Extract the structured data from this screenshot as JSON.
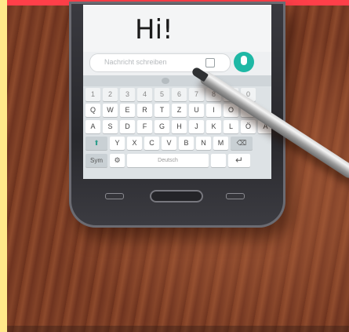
{
  "scene": {
    "message_text": "Hi!",
    "input_placeholder": "Nachricht schreiben",
    "keyboard": {
      "number_row": [
        "1",
        "2",
        "3",
        "4",
        "5",
        "6",
        "7",
        "8",
        "9",
        "0"
      ],
      "row1": [
        "Q",
        "W",
        "E",
        "R",
        "T",
        "Z",
        "U",
        "I",
        "O",
        "P"
      ],
      "row2": [
        "A",
        "S",
        "D",
        "F",
        "G",
        "H",
        "J",
        "K",
        "L",
        "Ö",
        "Ä"
      ],
      "row3": [
        "Y",
        "X",
        "C",
        "V",
        "B",
        "N",
        "M"
      ],
      "shift_key": "⬆",
      "backspace_key": "⌫",
      "sym_key": "Sym",
      "space_label": "Deutsch",
      "enter_key": "↵"
    },
    "colors": {
      "top_strip": "#ff3f49",
      "left_strip": "#ffe98a",
      "mic_button": "#1fb8a5"
    }
  }
}
